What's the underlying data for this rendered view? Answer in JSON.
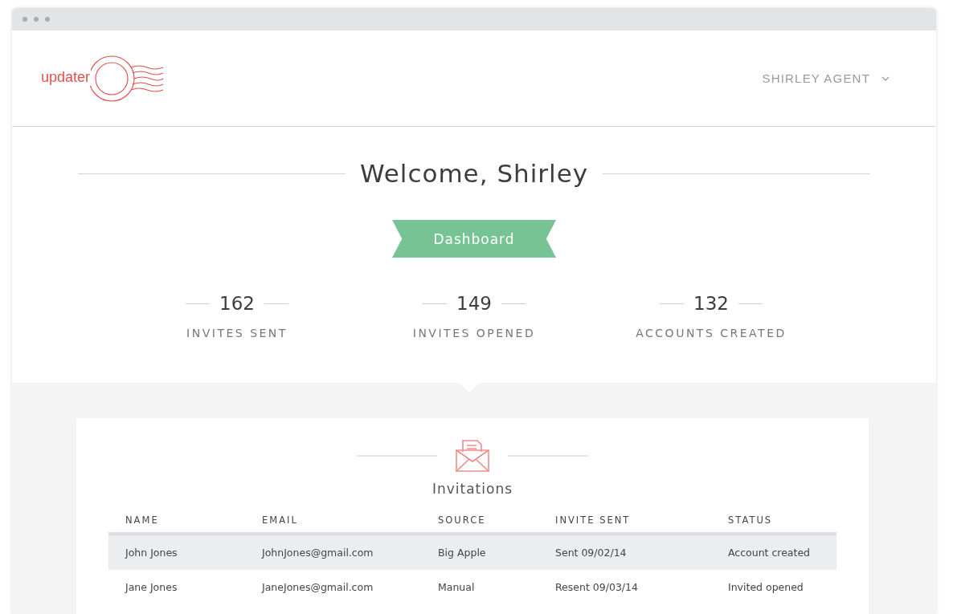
{
  "logo": {
    "text": "updater"
  },
  "user_menu": {
    "label": "SHIRLEY AGENT"
  },
  "welcome": {
    "title": "Welcome, Shirley"
  },
  "banner": {
    "label": "Dashboard"
  },
  "stats": [
    {
      "value": "162",
      "label": "INVITES SENT"
    },
    {
      "value": "149",
      "label": "INVITES OPENED"
    },
    {
      "value": "132",
      "label": "ACCOUNTS CREATED"
    }
  ],
  "invitations": {
    "title": "Invitations",
    "columns": [
      "NAME",
      "EMAIL",
      "SOURCE",
      "INVITE SENT",
      "STATUS"
    ],
    "rows": [
      {
        "selected": true,
        "cells": [
          "John Jones",
          "JohnJones@gmail.com",
          "Big Apple",
          "Sent 09/02/14",
          "Account created"
        ]
      },
      {
        "selected": false,
        "cells": [
          "Jane Jones",
          "JaneJones@gmail.com",
          "Manual",
          "Resent 09/03/14",
          "Invited opened"
        ]
      }
    ]
  }
}
